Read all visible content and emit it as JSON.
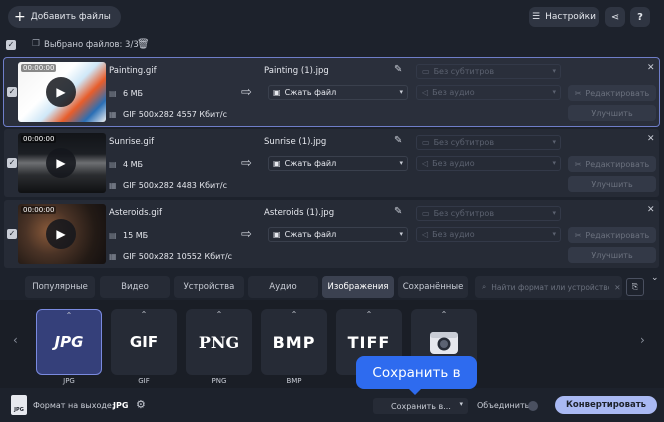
{
  "toolbar": {
    "add_files_label": "Добавить файлы",
    "settings_label": "Настройки"
  },
  "selection": {
    "label": "Выбрано файлов: 3/3"
  },
  "files": [
    {
      "duration": "00:00:00",
      "name": "Painting.gif",
      "size": "6 МБ",
      "info": "GIF 500x282 4557 Кбит/с",
      "output_name": "Painting (1).jpg",
      "compress_label": "Сжать файл",
      "subtitles": "Без субтитров",
      "audio": "Без аудио",
      "edit_label": "Редактировать",
      "enhance_label": "Улучшить"
    },
    {
      "duration": "00:00:00",
      "name": "Sunrise.gif",
      "size": "4 МБ",
      "info": "GIF 500x282 4483 Кбит/с",
      "output_name": "Sunrise (1).jpg",
      "compress_label": "Сжать файл",
      "subtitles": "Без субтитров",
      "audio": "Без аудио",
      "edit_label": "Редактировать",
      "enhance_label": "Улучшить"
    },
    {
      "duration": "00:00:00",
      "name": "Asteroids.gif",
      "size": "15 МБ",
      "info": "GIF 500x282 10552 Кбит/с",
      "output_name": "Asteroids (1).jpg",
      "compress_label": "Сжать файл",
      "subtitles": "Без субтитров",
      "audio": "Без аудио",
      "edit_label": "Редактировать",
      "enhance_label": "Улучшить"
    }
  ],
  "tabs": [
    {
      "label": "Популярные"
    },
    {
      "label": "Видео"
    },
    {
      "label": "Устройства"
    },
    {
      "label": "Аудио"
    },
    {
      "label": "Изображения",
      "active": true
    },
    {
      "label": "Сохранённые"
    }
  ],
  "search": {
    "placeholder": "Найти формат или устройство..."
  },
  "formats": [
    {
      "label": "JPG",
      "display": "JPG",
      "selected": true
    },
    {
      "label": "GIF",
      "display": "GIF"
    },
    {
      "label": "PNG",
      "display": "PNG"
    },
    {
      "label": "BMP",
      "display": "BMP"
    },
    {
      "label": "TIFF",
      "display": "TIFF"
    },
    {
      "label": "",
      "display": ""
    }
  ],
  "bottom": {
    "output_label": "Формат на выходе:",
    "output_value": "JPG",
    "output_icon_text": "JPG",
    "save_to_label": "Сохранить в...",
    "merge_label": "Объединить:",
    "convert_label": "Конвертировать"
  },
  "tooltip": {
    "text": "Сохранить в"
  },
  "colors": {
    "background": "#1d222c",
    "accent": "#a9b9f3",
    "tooltip": "#2e6bef",
    "selected_format": "#35407a"
  }
}
